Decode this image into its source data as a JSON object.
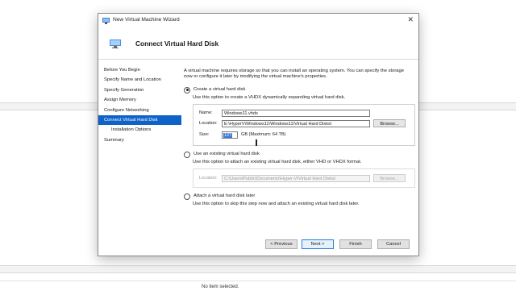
{
  "background": {
    "status_text": "No item selected."
  },
  "window": {
    "title": "New Virtual Machine Wizard",
    "close_glyph": "✕"
  },
  "header": {
    "title": "Connect Virtual Hard Disk"
  },
  "nav": {
    "items": [
      {
        "label": "Before You Begin"
      },
      {
        "label": "Specify Name and Location"
      },
      {
        "label": "Specify Generation"
      },
      {
        "label": "Assign Memory"
      },
      {
        "label": "Configure Networking"
      },
      {
        "label": "Connect Virtual Hard Disk"
      },
      {
        "label": "Installation Options"
      },
      {
        "label": "Summary"
      }
    ]
  },
  "content": {
    "intro": "A virtual machine requires storage so that you can install an operating system. You can specify the storage now or configure it later by modifying the virtual machine's properties.",
    "create": {
      "label": "Create a virtual hard disk",
      "description": "Use this option to create a VHDX dynamically expanding virtual hard disk.",
      "name_label": "Name:",
      "name_value": "Windows11.vhdx",
      "location_label": "Location:",
      "location_value": "E:\\HyperV\\Windows11\\Windows11\\Virtual Hard Disks\\",
      "browse_label": "Browse...",
      "size_label": "Size:",
      "size_value": "127",
      "size_suffix": "GB (Maximum: 64 TB)"
    },
    "existing": {
      "label": "Use an existing virtual hard disk",
      "description": "Use this option to attach an existing virtual hard disk, either VHD or VHDX format.",
      "location_label": "Location:",
      "location_value": "C:\\Users\\Public\\Documents\\Hyper-V\\Virtual Hard Disks\\",
      "browse_label": "Browse..."
    },
    "later": {
      "label": "Attach a virtual hard disk later",
      "description": "Use this option to skip this step now and attach an existing virtual hard disk later."
    }
  },
  "footer": {
    "previous": "< Previous",
    "next": "Next >",
    "finish": "Finish",
    "cancel": "Cancel"
  },
  "icons": {
    "title_icon": "hyperv-manager-icon",
    "header_icon": "virtual-disk-icon"
  },
  "colors": {
    "accent": "#0f62c8",
    "selection": "#3d7bd6",
    "primary_border": "#2a7ad8"
  }
}
